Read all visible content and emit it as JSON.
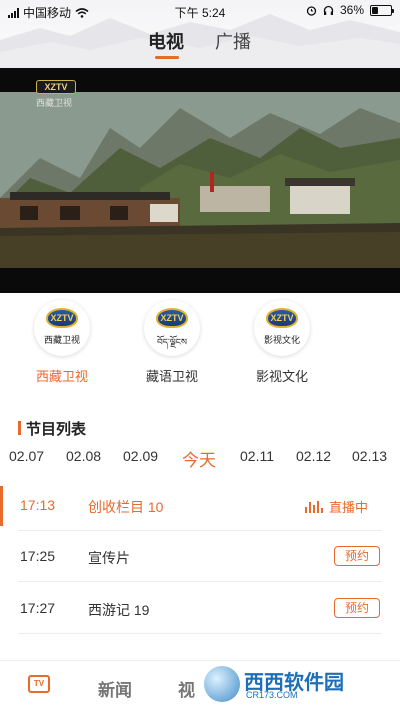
{
  "status_bar": {
    "carrier": "中国移动",
    "time": "下午 5:24",
    "battery": "36%",
    "battery_level": 0.36
  },
  "top_tabs": [
    {
      "label": "电视",
      "active": true
    },
    {
      "label": "广播",
      "active": false
    }
  ],
  "video": {
    "watermark_box": "XZTV",
    "watermark_text": "西藏卫视"
  },
  "channels": [
    {
      "logo_text": "西藏卫视",
      "name": "西藏卫视",
      "active": true
    },
    {
      "logo_text": "བོད་ལྗོངས",
      "name": "藏语卫视",
      "active": false
    },
    {
      "logo_text": "影视文化",
      "name": "影视文化",
      "active": false
    }
  ],
  "channel_logo_badge": "XZTV",
  "schedule": {
    "title": "节目列表",
    "dates": [
      "02.07",
      "02.08",
      "02.09",
      "今天",
      "02.11",
      "02.12",
      "02.13"
    ],
    "selected_date": "今天",
    "programs": [
      {
        "time": "17:13",
        "title": "创收栏目 10",
        "status": "直播中"
      },
      {
        "time": "17:25",
        "title": "宣传片",
        "status": "预约"
      },
      {
        "time": "17:27",
        "title": "西游记 19",
        "status": "预约"
      }
    ]
  },
  "bottom_nav": {
    "tv_icon_text": "TV",
    "items": [
      "新闻",
      "视"
    ]
  },
  "watermark": {
    "brand": "西西软件园",
    "url": "CR173.COM"
  },
  "colors": {
    "accent": "#e86a2c"
  }
}
